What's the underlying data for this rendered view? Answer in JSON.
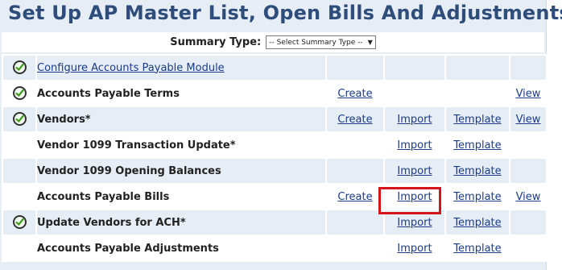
{
  "page": {
    "title": "Set Up AP Master List, Open Bills And Adjustments"
  },
  "summary": {
    "label": "Summary Type:",
    "select_value": "-- Select Summary Type --"
  },
  "rows": [
    {
      "name": "Configure Accounts Payable Module",
      "checked": true,
      "create": "",
      "import": "",
      "template": "",
      "view": ""
    },
    {
      "name": "Accounts Payable Terms",
      "checked": true,
      "create": "Create",
      "import": "",
      "template": "",
      "view": "View"
    },
    {
      "name": "Vendors*",
      "checked": true,
      "create": "Create",
      "import": "Import",
      "template": "Template",
      "view": "View"
    },
    {
      "name": "Vendor 1099 Transaction Update*",
      "checked": false,
      "create": "",
      "import": "Import",
      "template": "Template",
      "view": ""
    },
    {
      "name": "Vendor 1099 Opening Balances",
      "checked": false,
      "create": "",
      "import": "Import",
      "template": "Template",
      "view": ""
    },
    {
      "name": "Accounts Payable Bills",
      "checked": false,
      "create": "Create",
      "import": "Import",
      "template": "Template",
      "view": "View"
    },
    {
      "name": "Update Vendors for ACH*",
      "checked": true,
      "create": "",
      "import": "Import",
      "template": "Template",
      "view": ""
    },
    {
      "name": "Accounts Payable Adjustments",
      "checked": false,
      "create": "",
      "import": "Import",
      "template": "Template",
      "view": ""
    }
  ],
  "highlight": {
    "row": "Accounts Payable Bills",
    "action": "Import",
    "color": "#d4161c"
  },
  "icons": {
    "check": "check-circle-icon",
    "dropdown": "chevron-down-icon"
  },
  "colors": {
    "title": "#2e4d7b",
    "link": "#1a3a8c",
    "row_alt": "#e7edf5",
    "check": "#3f9b1f"
  }
}
